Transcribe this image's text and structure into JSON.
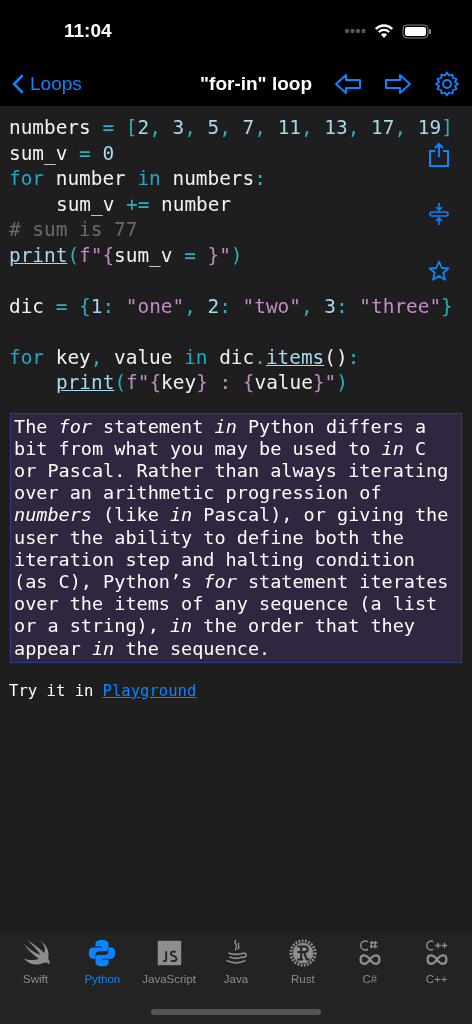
{
  "status_bar": {
    "time": "11:04"
  },
  "nav_bar": {
    "back_label": "Loops",
    "title": "\"for-in\" loop"
  },
  "code_lines": [
    {
      "kind": "code",
      "tokens": [
        {
          "text": "numbers ",
          "kind": "plain"
        },
        {
          "text": "= ",
          "kind": "op"
        },
        {
          "text": "[",
          "kind": "op"
        },
        {
          "text": "2",
          "kind": "number"
        },
        {
          "text": ", ",
          "kind": "op"
        },
        {
          "text": "3",
          "kind": "number"
        },
        {
          "text": ", ",
          "kind": "op"
        },
        {
          "text": "5",
          "kind": "number"
        },
        {
          "text": ", ",
          "kind": "op"
        },
        {
          "text": "7",
          "kind": "number"
        },
        {
          "text": ", ",
          "kind": "op"
        },
        {
          "text": "11",
          "kind": "number"
        },
        {
          "text": ", ",
          "kind": "op"
        },
        {
          "text": "13",
          "kind": "number"
        },
        {
          "text": ", ",
          "kind": "op"
        },
        {
          "text": "17",
          "kind": "number"
        },
        {
          "text": ", ",
          "kind": "op"
        },
        {
          "text": "19",
          "kind": "number"
        },
        {
          "text": "]",
          "kind": "op"
        }
      ]
    },
    {
      "kind": "code",
      "tokens": [
        {
          "text": "sum_v ",
          "kind": "plain"
        },
        {
          "text": "= ",
          "kind": "op"
        },
        {
          "text": "0",
          "kind": "number"
        }
      ]
    },
    {
      "kind": "code",
      "tokens": [
        {
          "text": "for ",
          "kind": "keyword"
        },
        {
          "text": "number ",
          "kind": "plain"
        },
        {
          "text": "in ",
          "kind": "keyword"
        },
        {
          "text": "numbers",
          "kind": "plain"
        },
        {
          "text": ":",
          "kind": "op"
        }
      ]
    },
    {
      "kind": "code",
      "indent": true,
      "tokens": [
        {
          "text": "sum_v ",
          "kind": "plain"
        },
        {
          "text": "+= ",
          "kind": "op"
        },
        {
          "text": "number",
          "kind": "plain"
        }
      ]
    },
    {
      "kind": "code",
      "tokens": [
        {
          "text": "# sum is 77",
          "kind": "comment"
        }
      ]
    },
    {
      "kind": "code",
      "tokens": [
        {
          "text": "print",
          "kind": "func"
        },
        {
          "text": "(",
          "kind": "op"
        },
        {
          "text": "f\"{",
          "kind": "string"
        },
        {
          "text": "sum_v ",
          "kind": "plain"
        },
        {
          "text": "= ",
          "kind": "op"
        },
        {
          "text": "}\"",
          "kind": "string"
        },
        {
          "text": ")",
          "kind": "op"
        }
      ]
    },
    {
      "kind": "blank"
    },
    {
      "kind": "code",
      "tokens": [
        {
          "text": "dic ",
          "kind": "plain"
        },
        {
          "text": "= ",
          "kind": "op"
        },
        {
          "text": "{",
          "kind": "op"
        },
        {
          "text": "1",
          "kind": "number"
        },
        {
          "text": ": ",
          "kind": "op"
        },
        {
          "text": "\"one\"",
          "kind": "string"
        },
        {
          "text": ", ",
          "kind": "op"
        },
        {
          "text": "2",
          "kind": "number"
        },
        {
          "text": ": ",
          "kind": "op"
        },
        {
          "text": "\"two\"",
          "kind": "string"
        },
        {
          "text": ", ",
          "kind": "op"
        },
        {
          "text": "3",
          "kind": "number"
        },
        {
          "text": ": ",
          "kind": "op"
        },
        {
          "text": "\"three\"",
          "kind": "string"
        },
        {
          "text": "}",
          "kind": "op"
        }
      ]
    },
    {
      "kind": "blank"
    },
    {
      "kind": "code",
      "tokens": [
        {
          "text": "for ",
          "kind": "keyword"
        },
        {
          "text": "key",
          "kind": "plain"
        },
        {
          "text": ", ",
          "kind": "op"
        },
        {
          "text": "value ",
          "kind": "plain"
        },
        {
          "text": "in ",
          "kind": "keyword"
        },
        {
          "text": "dic",
          "kind": "plain"
        },
        {
          "text": ".",
          "kind": "op"
        },
        {
          "text": "items",
          "kind": "func"
        },
        {
          "text": "()",
          "kind": "plain"
        },
        {
          "text": ":",
          "kind": "op"
        }
      ]
    },
    {
      "kind": "code",
      "indent": true,
      "tokens": [
        {
          "text": "print",
          "kind": "func"
        },
        {
          "text": "(",
          "kind": "op"
        },
        {
          "text": "f\"{",
          "kind": "string"
        },
        {
          "text": "key",
          "kind": "plain"
        },
        {
          "text": "} : {",
          "kind": "string"
        },
        {
          "text": "value",
          "kind": "plain"
        },
        {
          "text": "}\"",
          "kind": "string"
        },
        {
          "text": ")",
          "kind": "op"
        }
      ]
    }
  ],
  "description": "The *for* statement *in* Python differs a bit from what you may be used to *in* C or Pascal. Rather than always iterating over an arithmetic progression of *numbers* (like *in* Pascal), or giving the user the ability to define both the iteration step and halting condition (as C), Python’s *for* statement iterates over the items of any sequence (a list or a string), *in* the order that they appear *in* the sequence.",
  "try_it": {
    "text": "Try it in",
    "link": "Playground"
  },
  "tabs": [
    {
      "label": "Swift",
      "kind": "swift",
      "selected": false
    },
    {
      "label": "Python",
      "kind": "python",
      "selected": true
    },
    {
      "label": "JavaScript",
      "kind": "javascript",
      "selected": false
    },
    {
      "label": "Java",
      "kind": "java",
      "selected": false
    },
    {
      "label": "Rust",
      "kind": "rust",
      "selected": false
    },
    {
      "label": "C#",
      "kind": "csharp",
      "selected": false
    },
    {
      "label": "C++",
      "kind": "cpp",
      "selected": false
    }
  ]
}
